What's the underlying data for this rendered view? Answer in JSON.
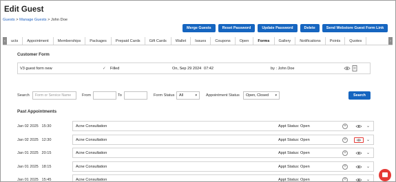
{
  "page_title": "Edit Guest",
  "breadcrumb": {
    "item1": "Guests",
    "sep1": " > ",
    "item2": "Manage Guests",
    "sep2": " > ",
    "current": "John Doe"
  },
  "actions": {
    "merge": "Merge Guests",
    "reset_password": "Reset Password",
    "update_password": "Update Password",
    "delete": "Delete",
    "send_link": "Send Webstore Guest Form Link"
  },
  "tabs": [
    {
      "label": "ucts"
    },
    {
      "label": "Appointment"
    },
    {
      "label": "Memberships"
    },
    {
      "label": "Packages"
    },
    {
      "label": "Prepaid Cards"
    },
    {
      "label": "Gift Cards"
    },
    {
      "label": "Wallet"
    },
    {
      "label": "Issues"
    },
    {
      "label": "Coupons"
    },
    {
      "label": "Open"
    },
    {
      "label": "Forms"
    },
    {
      "label": "Gallery"
    },
    {
      "label": "Notifications"
    },
    {
      "label": "Points"
    },
    {
      "label": "Quotes"
    }
  ],
  "active_tab": "Forms",
  "customer_form": {
    "title": "Customer Form",
    "name": "V3 guest form new",
    "status_check": "✓",
    "status": "Filled",
    "date": "On, Sep 29 2024",
    "time": "07:42",
    "by": "by : John Doe"
  },
  "filters": {
    "search_label": "Search",
    "search_placeholder": "Form or Service Name",
    "from_label": "From",
    "to_label": "To",
    "form_status_label": "Form Status",
    "form_status_value": "All",
    "appt_status_label": "Appointment Status",
    "appt_status_value": "Open, Closed",
    "search_button": "Search"
  },
  "past_appointments": {
    "title": "Past Appointments",
    "rows": [
      {
        "date": "Jan 02 2025",
        "time": "15:30",
        "service": "Acne Consultation",
        "status": "Appt Status: Open"
      },
      {
        "date": "Jan 02 2025",
        "time": "12:30",
        "service": "Acne Consultation",
        "status": "Appt Status: Open"
      },
      {
        "date": "Jan 01 2025",
        "time": "20:15",
        "service": "Acne Consultation",
        "status": "Appt Status: Open"
      },
      {
        "date": "Jan 01 2025",
        "time": "18:15",
        "service": "Acne Consultation",
        "status": "Appt Status: Open"
      },
      {
        "date": "Jan 01 2025",
        "time": "15:45",
        "service": "Acne Consultation",
        "status": "Appt Status: Open"
      }
    ]
  },
  "colors": {
    "primary": "#1565c0",
    "highlight": "#e53935",
    "link": "#1d5fbf"
  }
}
